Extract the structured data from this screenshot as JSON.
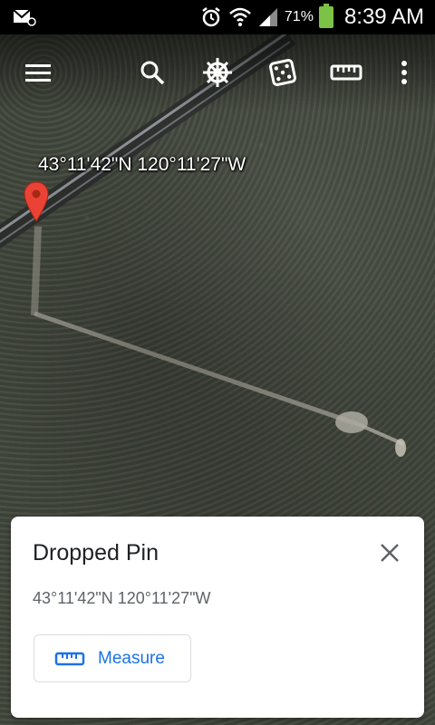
{
  "status_bar": {
    "battery_percent": "71%",
    "time": "8:39 AM"
  },
  "toolbar": {
    "icons": [
      "menu-icon",
      "search-icon",
      "voyager-icon",
      "feeling-lucky-icon",
      "measure-icon",
      "more-icon"
    ]
  },
  "map": {
    "coordinates_label": "43°11'42\"N 120°11'27\"W",
    "marker_color": "#ea4335"
  },
  "card": {
    "title": "Dropped Pin",
    "coordinates": "43°11'42\"N 120°11'27\"W",
    "measure_label": "Measure",
    "accent_color": "#1a73e8"
  }
}
